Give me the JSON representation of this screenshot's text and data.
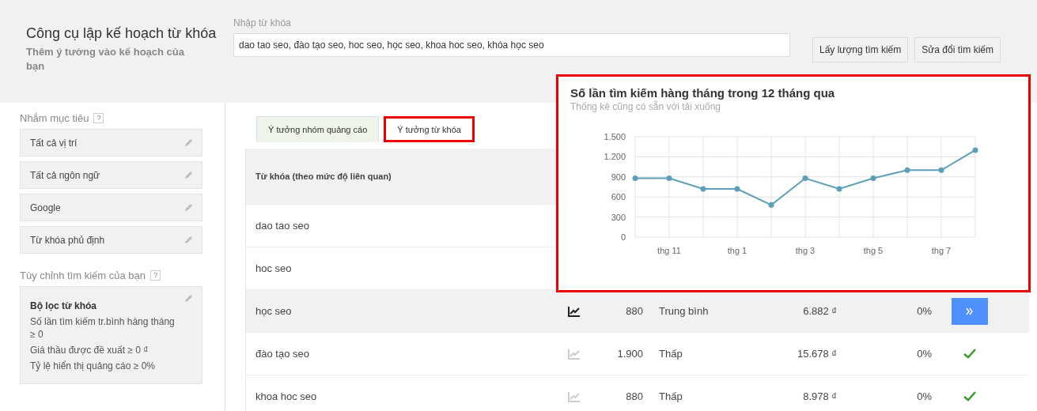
{
  "header": {
    "title": "Công cụ lập kế hoạch từ khóa",
    "subtitle": "Thêm ý tưởng vào kế hoạch của bạn",
    "input_label": "Nhập từ khóa",
    "input_value": "dao tao seo, đào tạo seo, hoc seo, học seo, khoa hoc seo, khóa học seo",
    "buttons": [
      "Lấy lượng tìm kiếm",
      "Sửa đổi tìm kiếm"
    ]
  },
  "sidebar": {
    "targeting_title": "Nhắm mục tiêu",
    "help": "?",
    "targeting_items": [
      "Tất cả vị trí",
      "Tất cả ngôn ngữ",
      "Google",
      "Từ khóa phủ định"
    ],
    "customize_title": "Tùy chỉnh tìm kiếm của bạn",
    "customize_help": "?",
    "filter": {
      "title": "Bộ lọc từ khóa",
      "lines": [
        "Số lần tìm kiếm tr.bình hàng tháng ≥ 0",
        "Giá thầu được đề xuất ≥ 0 ₫",
        "Tỷ lệ hiển thị quảng cáo ≥ 0%"
      ]
    }
  },
  "tabs": [
    {
      "label": "Ý tưởng nhóm quảng cáo",
      "selected": false,
      "highlighted": false
    },
    {
      "label": "Ý tưởng từ khóa",
      "selected": true,
      "highlighted": true
    }
  ],
  "table": {
    "columns": [
      "Từ khóa (theo mức độ liên quan)"
    ],
    "rows": [
      {
        "keyword": "dao tao seo",
        "selected": false
      },
      {
        "keyword": "hoc seo",
        "selected": false
      },
      {
        "keyword": "học seo",
        "selected": true,
        "volume": "880",
        "competition": "Trung bình",
        "bid": "6.882 ₫",
        "share": "0%",
        "added": false
      },
      {
        "keyword": "đào tạo seo",
        "selected": false,
        "volume": "1.900",
        "competition": "Thấp",
        "bid": "15.678 ₫",
        "share": "0%",
        "added": true
      },
      {
        "keyword": "khoa hoc seo",
        "selected": false,
        "volume": "880",
        "competition": "Thấp",
        "bid": "8.978 ₫",
        "share": "0%",
        "added": true
      }
    ]
  },
  "popup": {
    "title": "Số lần tìm kiếm hàng tháng trong 12 tháng qua",
    "subtitle": "Thống kê cũng có sẵn với tải xuống",
    "chart_data": {
      "type": "line",
      "categories": [
        null,
        "thg 11",
        null,
        "thg 1",
        null,
        "thg 3",
        null,
        "thg 5",
        null,
        "thg 7",
        null
      ],
      "grid": true,
      "series": [
        {
          "color": "#5b9fb8",
          "marker": true,
          "values": [
            880,
            880,
            720,
            720,
            480,
            880,
            720,
            880,
            1000,
            1000,
            1300
          ]
        }
      ],
      "ylim": [
        0,
        1500
      ],
      "yticks": [
        {
          "value": 0,
          "label": "0"
        },
        {
          "value": 300,
          "label": "300"
        },
        {
          "value": 600,
          "label": "600"
        },
        {
          "value": 900,
          "label": "900"
        },
        {
          "value": 1200,
          "label": "1.200"
        },
        {
          "value": 1500,
          "label": "1.500"
        }
      ]
    }
  }
}
